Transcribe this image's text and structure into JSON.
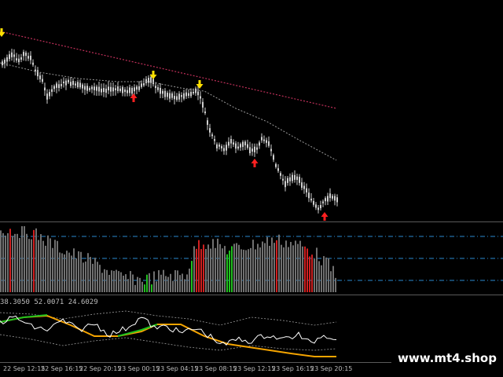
{
  "chart_window": {
    "indicator_readout": "38.3050 52.0071 24.6029",
    "time_labels": [
      "22 Sep 12:15",
      "22 Sep 16:15",
      "22 Sep 20:15",
      "23 Sep 00:15",
      "23 Sep 04:15",
      "23 Sep 08:15",
      "23 Sep 12:15",
      "23 Sep 16:15",
      "23 Sep 20:15"
    ],
    "watermark": "www.mt4.shop"
  },
  "colors": {
    "background": "#000000",
    "candles": "#cfcfcf",
    "long_ma": "#c0305a",
    "short_ma": "#9a9a9a",
    "sell_arrow": "#ffe000",
    "buy_arrow": "#ff2020",
    "level_lines": "#2a8ad0",
    "histogram_neutral": "#707070",
    "histogram_up": "#22c020",
    "histogram_down": "#d02020",
    "oscillator_line": "#ffffff",
    "trend_line_orange": "#f5a400",
    "trend_line_green": "#1ec01e",
    "band_lines": "#9a9a9a"
  },
  "arrows": {
    "sell_icon": "down-arrow-icon",
    "buy_icon": "up-arrow-icon"
  }
}
